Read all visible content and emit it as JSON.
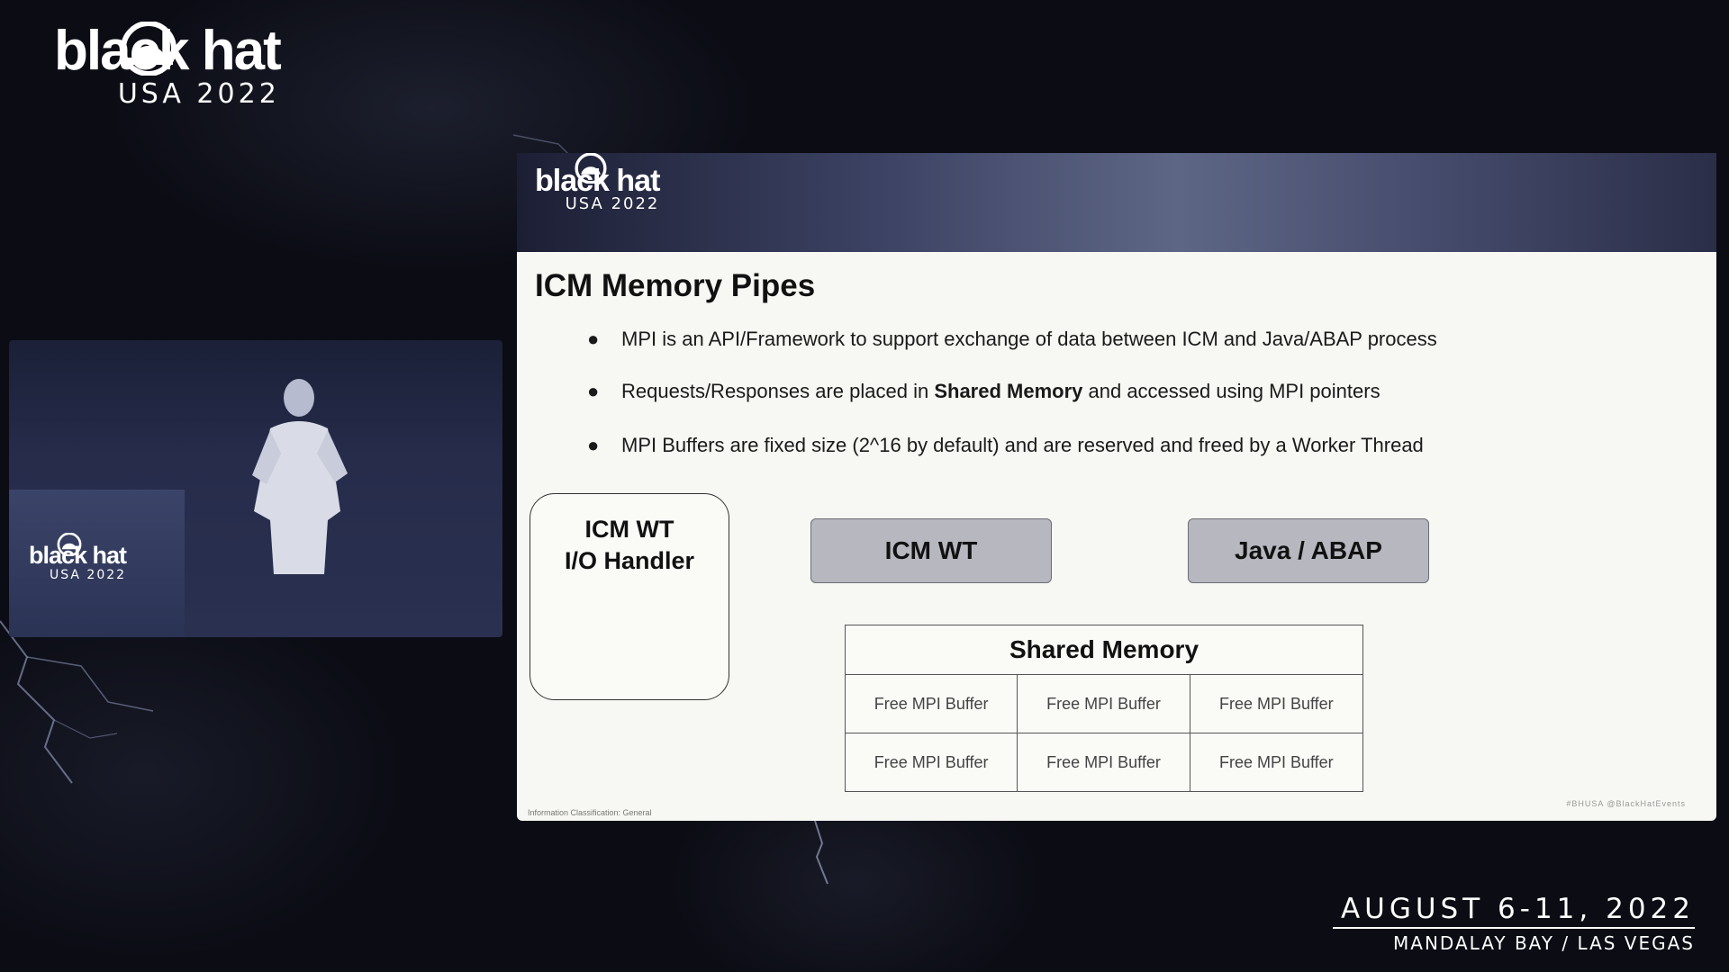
{
  "brand": {
    "logo_word": "black hat",
    "logo_sub": "USA 2022"
  },
  "slide": {
    "title": "ICM Memory Pipes",
    "bullets": [
      {
        "pre": "MPI is an API/Framework to support exchange of data between ICM and Java/ABAP process",
        "bold": "",
        "post": ""
      },
      {
        "pre": "Requests/Responses are placed in ",
        "bold": "Shared Memory",
        "post": " and accessed using MPI pointers"
      },
      {
        "pre": "MPI Buffers are fixed size (2^16 by default) and are reserved and freed by a Worker Thread",
        "bold": "",
        "post": ""
      }
    ],
    "diagram": {
      "io_handler": {
        "line1": "ICM WT",
        "line2": "I/O Handler"
      },
      "icm_wt": "ICM WT",
      "java_abap": "Java / ABAP",
      "shared_memory": {
        "title": "Shared Memory",
        "cells": [
          "Free MPI Buffer",
          "Free MPI Buffer",
          "Free MPI Buffer",
          "Free MPI Buffer",
          "Free MPI Buffer",
          "Free MPI Buffer"
        ]
      }
    },
    "footer_left": "Information Classification: General",
    "footer_right": "#BHUSA   @BlackHatEvents"
  },
  "event": {
    "dates": "AUGUST 6-11, 2022",
    "venue": "MANDALAY BAY / LAS VEGAS"
  },
  "colors": {
    "background": "#0b0c14",
    "slide_bg": "#f7f7f3",
    "grey_box": "#b7b8bf"
  }
}
